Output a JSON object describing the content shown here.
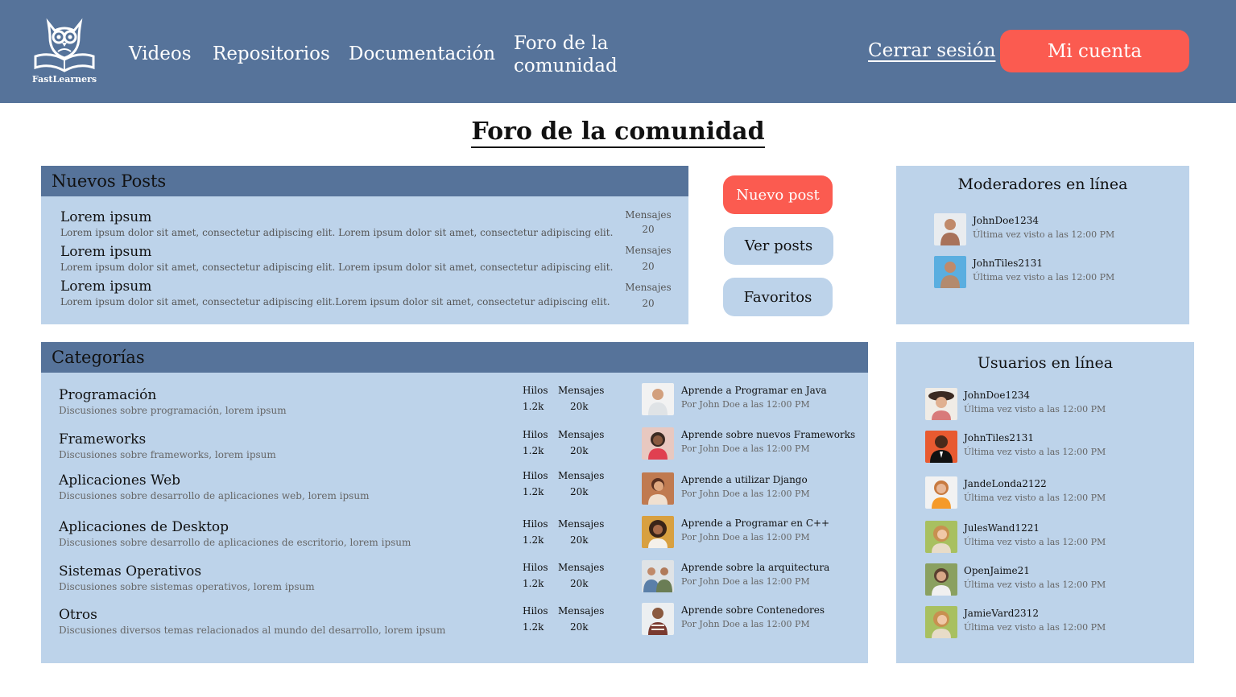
{
  "brand": {
    "name": "FastLearners"
  },
  "nav": {
    "videos": "Videos",
    "repos": "Repositorios",
    "docs": "Documentación",
    "foro": "Foro de la comunidad",
    "logout": "Cerrar sesión",
    "account": "Mi cuenta"
  },
  "page": {
    "title": "Foro de la comunidad"
  },
  "posts": {
    "heading": "Nuevos Posts",
    "items": [
      {
        "title": "Lorem ipsum",
        "desc": "Lorem ipsum dolor sit amet, consectetur adipiscing elit. Lorem ipsum dolor sit amet, consectetur adipiscing elit.",
        "stat_label": "Mensajes",
        "stat_value": "20"
      },
      {
        "title": "Lorem ipsum",
        "desc": "Lorem ipsum dolor sit amet, consectetur adipiscing elit. Lorem ipsum dolor sit amet, consectetur adipiscing elit.",
        "stat_label": "Mensajes",
        "stat_value": "20"
      },
      {
        "title": "Lorem ipsum",
        "desc": "Lorem ipsum dolor sit amet, consectetur adipiscing elit.Lorem ipsum dolor sit amet, consectetur adipiscing elit.",
        "stat_label": "Mensajes",
        "stat_value": "20"
      }
    ]
  },
  "actions": {
    "new_post": "Nuevo post",
    "view_posts": "Ver posts",
    "favorites": "Favoritos"
  },
  "moderators": {
    "heading": "Moderadores en línea",
    "items": [
      {
        "name": "JohnDoe1234",
        "seen": "Última vez visto a las 12:00 PM"
      },
      {
        "name": "JohnTiles2131",
        "seen": "Última vez visto a las 12:00 PM"
      }
    ]
  },
  "categories": {
    "heading": "Categorías",
    "threads_label": "Hilos",
    "messages_label": "Mensajes",
    "items": [
      {
        "title": "Programación",
        "desc": "Discusiones sobre programación, lorem ipsum",
        "threads": "1.2k",
        "messages": "20k",
        "last_title": "Aprende a Programar en Java",
        "last_by": "Por John Doe a las 12:00 PM"
      },
      {
        "title": "Frameworks",
        "desc": "Discusiones sobre frameworks, lorem ipsum",
        "threads": "1.2k",
        "messages": "20k",
        "last_title": "Aprende sobre nuevos Frameworks",
        "last_by": "Por John Doe a las 12:00 PM"
      },
      {
        "title": "Aplicaciones Web",
        "desc": "Discusiones sobre desarrollo de aplicaciones web, lorem ipsum",
        "threads": "1.2k",
        "messages": "20k",
        "last_title": "Aprende a utilizar Django",
        "last_by": "Por John Doe a las 12:00 PM"
      },
      {
        "title": "Aplicaciones de Desktop",
        "desc": "Discusiones sobre desarrollo de aplicaciones de escritorio, lorem ipsum",
        "threads": "1.2k",
        "messages": "20k",
        "last_title": "Aprende a Programar en C++",
        "last_by": "Por John Doe a las 12:00 PM"
      },
      {
        "title": "Sistemas Operativos",
        "desc": "Discusiones sobre sistemas operativos, lorem ipsum",
        "threads": "1.2k",
        "messages": "20k",
        "last_title": "Aprende  sobre la arquitectura",
        "last_by": "Por John Doe a las 12:00 PM"
      },
      {
        "title": "Otros",
        "desc": "Discusiones diversos temas relacionados al mundo del desarrollo, lorem ipsum",
        "threads": "1.2k",
        "messages": "20k",
        "last_title": "Aprende sobre Contenedores",
        "last_by": "Por John Doe a las 12:00 PM"
      }
    ]
  },
  "online_users": {
    "heading": "Usuarios en línea",
    "items": [
      {
        "name": "JohnDoe1234",
        "seen": "Última vez visto a las 12:00 PM"
      },
      {
        "name": "JohnTiles2131",
        "seen": "Última vez visto a las 12:00 PM"
      },
      {
        "name": "JandeLonda2122",
        "seen": "Última vez visto a las 12:00 PM"
      },
      {
        "name": "JulesWand1221",
        "seen": "Última vez visto a las 12:00 PM"
      },
      {
        "name": "OpenJaime21",
        "seen": "Última vez visto a las 12:00 PM"
      },
      {
        "name": "JamieVard2312",
        "seen": "Última vez visto a las 12:00 PM"
      }
    ]
  },
  "colors": {
    "header": "#56739a",
    "panel": "#bdd3ea",
    "accent": "#fb5b50"
  }
}
